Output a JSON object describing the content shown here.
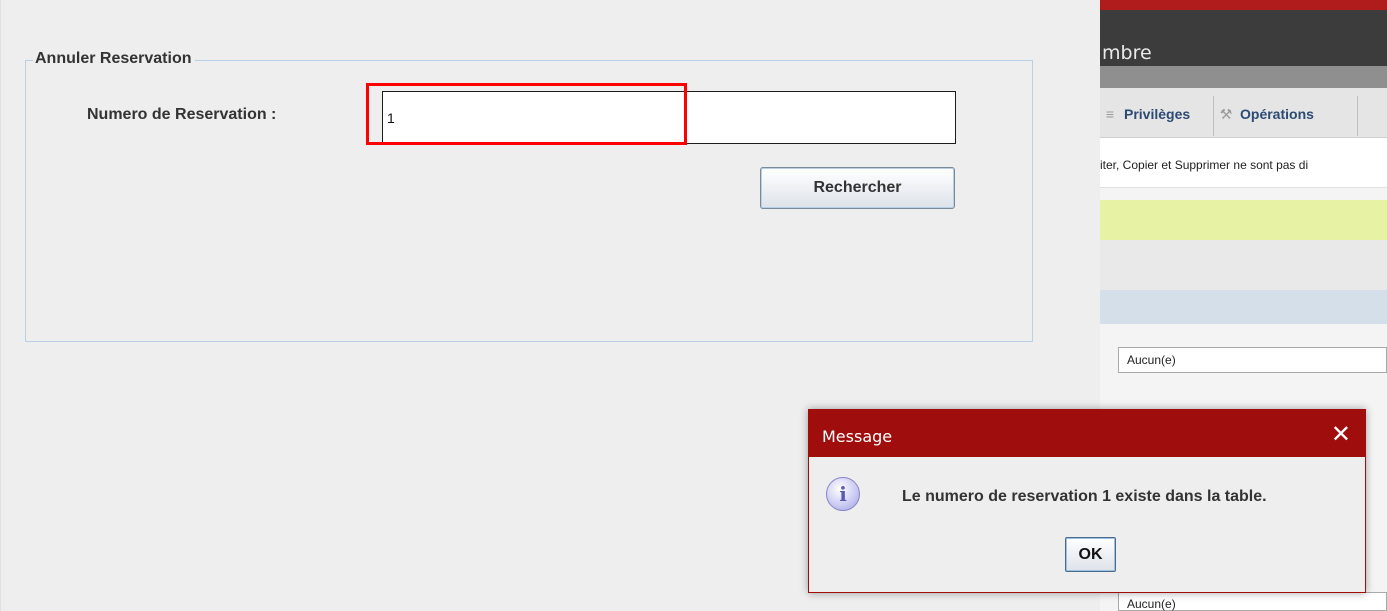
{
  "background_window": {
    "title_fragment": "mbre",
    "tabs": [
      {
        "label": "Privilèges",
        "icon": "list-icon"
      },
      {
        "label": "Opérations",
        "icon": "wrench-icon"
      }
    ],
    "notice_fragment": "iter, Copier et Supprimer ne sont pas di",
    "select_1_value": "Aucun(e)",
    "select_2_value": "Aucun(e)"
  },
  "form": {
    "fieldset_legend": "Annuler Reservation",
    "reservation_label": "Numero de Reservation :",
    "reservation_value": "1",
    "search_button": "Rechercher"
  },
  "dialog": {
    "title": "Message",
    "close_glyph": "✕",
    "icon": "info-icon",
    "icon_glyph": "i",
    "message": "Le numero de reservation 1 existe dans la table.",
    "ok_button": "OK"
  },
  "colors": {
    "dialog_titlebar": "#a00d0d",
    "highlight": "#ff0000",
    "form_background": "#eeeeee"
  }
}
